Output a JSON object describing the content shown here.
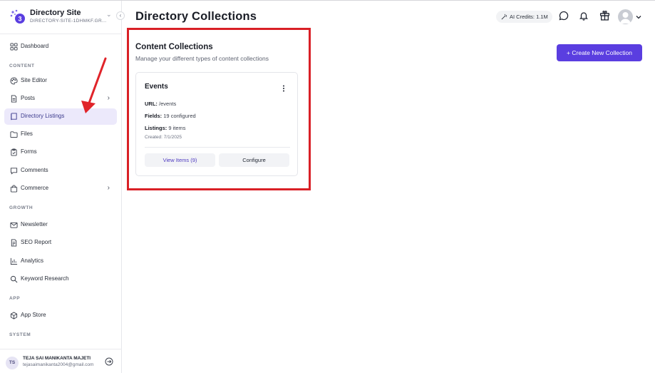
{
  "brand": {
    "name": "Directory Site",
    "subtitle": "DIRECTORY-SITE-1DHMKF.GR..."
  },
  "sidebar": {
    "dashboard": "Dashboard",
    "section_content": "CONTENT",
    "site_editor": "Site Editor",
    "posts": "Posts",
    "directory_listings": "Directory Listings",
    "files": "Files",
    "forms": "Forms",
    "comments": "Comments",
    "commerce": "Commerce",
    "section_growth": "GROWTH",
    "newsletter": "Newsletter",
    "seo_report": "SEO Report",
    "analytics": "Analytics",
    "keyword_research": "Keyword Research",
    "section_app": "APP",
    "app_store": "App Store",
    "section_system": "SYSTEM"
  },
  "user": {
    "initials": "TS",
    "name": "TEJA SAI MANIKANTA MAJETI",
    "email": "tejasaimanikanta2004@gmail.com"
  },
  "header": {
    "title": "Directory Collections",
    "credits": "AI Credits: 1.1M"
  },
  "main": {
    "section_title": "Content Collections",
    "section_subtitle": "Manage your different types of content collections",
    "new_button": "+ Create New Collection",
    "card": {
      "title": "Events",
      "url_label": "URL:",
      "url_value": "/events",
      "fields_label": "Fields:",
      "fields_value": "19 configured",
      "listings_label": "Listings:",
      "listings_value": "9 items",
      "created": "Created: 7/1/2025",
      "view_button": "View Items (9)",
      "configure_button": "Configure"
    }
  },
  "colors": {
    "accent": "#5a3ee0",
    "highlight_box": "#d92026",
    "active_nav_bg": "#ece9fb"
  }
}
